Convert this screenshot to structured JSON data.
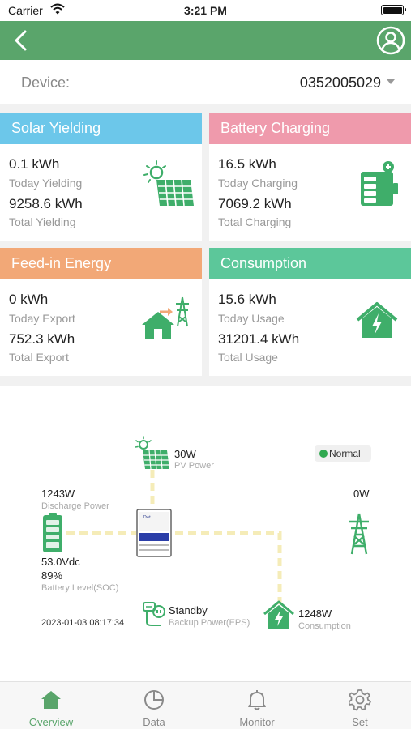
{
  "status_bar": {
    "carrier": "Carrier",
    "time": "3:21 PM"
  },
  "device": {
    "label": "Device:",
    "value": "0352005029"
  },
  "cards": {
    "solar": {
      "title": "Solar Yielding",
      "today_value": "0.1 kWh",
      "today_label": "Today Yielding",
      "total_value": "9258.6 kWh",
      "total_label": "Total Yielding",
      "icon": "solar-panel-icon"
    },
    "battery": {
      "title": "Battery Charging",
      "today_value": "16.5 kWh",
      "today_label": "Today Charging",
      "total_value": "7069.2 kWh",
      "total_label": "Total Charging",
      "icon": "battery-charge-icon"
    },
    "feedin": {
      "title": "Feed-in Energy",
      "today_value": "0 kWh",
      "today_label": "Today Export",
      "total_value": "752.3 kWh",
      "total_label": "Total Export",
      "icon": "house-to-grid-icon"
    },
    "consumption": {
      "title": "Consumption",
      "today_value": "15.6 kWh",
      "today_label": "Today Usage",
      "total_value": "31201.4 kWh",
      "total_label": "Total Usage",
      "icon": "house-power-icon"
    }
  },
  "flow": {
    "status": "Normal",
    "pv": {
      "value": "30W",
      "label": "PV Power"
    },
    "discharge": {
      "value": "1243W",
      "label": "Discharge Power"
    },
    "battery": {
      "voltage": "53.0Vdc",
      "soc": "89%",
      "label": "Battery Level(SOC)"
    },
    "grid": {
      "value": "0W"
    },
    "eps": {
      "value": "Standby",
      "label": "Backup Power(EPS)"
    },
    "consumption": {
      "value": "1248W",
      "label": "Consumption"
    },
    "timestamp": "2023-01-03 08:17:34"
  },
  "tabs": [
    {
      "label": "Overview",
      "icon": "home-icon",
      "active": true
    },
    {
      "label": "Data",
      "icon": "pie-chart-icon",
      "active": false
    },
    {
      "label": "Monitor",
      "icon": "bell-icon",
      "active": false
    },
    {
      "label": "Set",
      "icon": "gear-icon",
      "active": false
    }
  ],
  "colors": {
    "primary": "#5aa56b",
    "solar": "#6cc7ea",
    "battery": "#ef9aac",
    "feedin": "#f2a877",
    "consumption": "#5cc79a",
    "flow_line": "#f5ecb8",
    "icon_green": "#3fae6a"
  }
}
